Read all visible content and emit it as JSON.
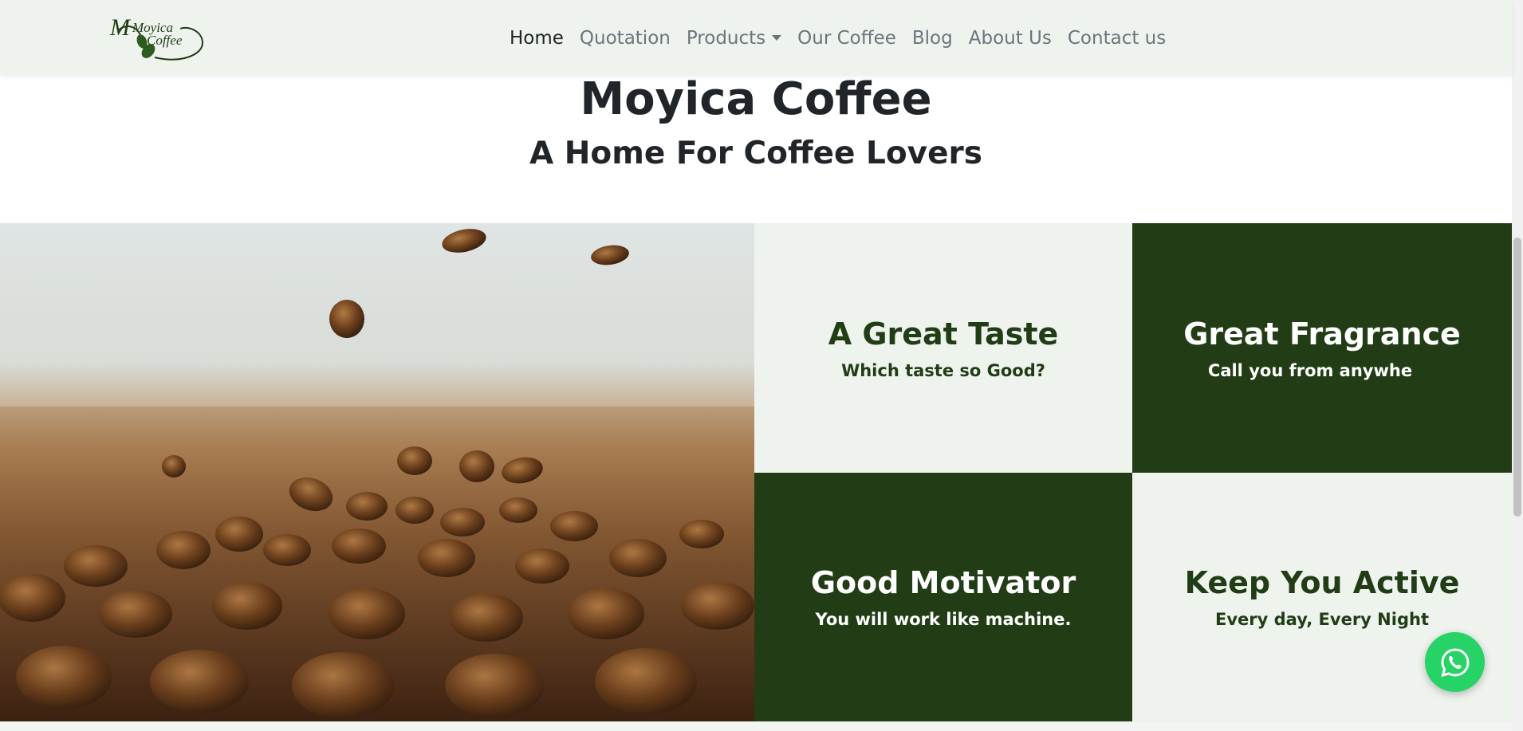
{
  "brand": {
    "logo_line1": "Moyica",
    "logo_line2": "Coffee"
  },
  "nav": {
    "items": [
      {
        "label": "Home",
        "active": true
      },
      {
        "label": "Quotation"
      },
      {
        "label": "Products",
        "dropdown": true
      },
      {
        "label": "Our Coffee"
      },
      {
        "label": "Blog"
      },
      {
        "label": "About Us"
      },
      {
        "label": "Contact us"
      }
    ]
  },
  "hero": {
    "title": "Moyica Coffee",
    "subtitle": "A Home For Coffee Lovers"
  },
  "features": [
    {
      "title": "A Great Taste",
      "subtitle": "Which taste so Good?"
    },
    {
      "title": "Great Fragrance",
      "subtitle": "Call you from anywhe"
    },
    {
      "title": "Good Motivator",
      "subtitle": "You will work like machine."
    },
    {
      "title": "Keep You Active",
      "subtitle": "Every day, Every Night"
    }
  ],
  "floating": {
    "icon": "whatsapp-icon"
  },
  "colors": {
    "dark_green": "#223d15",
    "light_green": "#eef3ee",
    "whatsapp": "#25d366"
  }
}
